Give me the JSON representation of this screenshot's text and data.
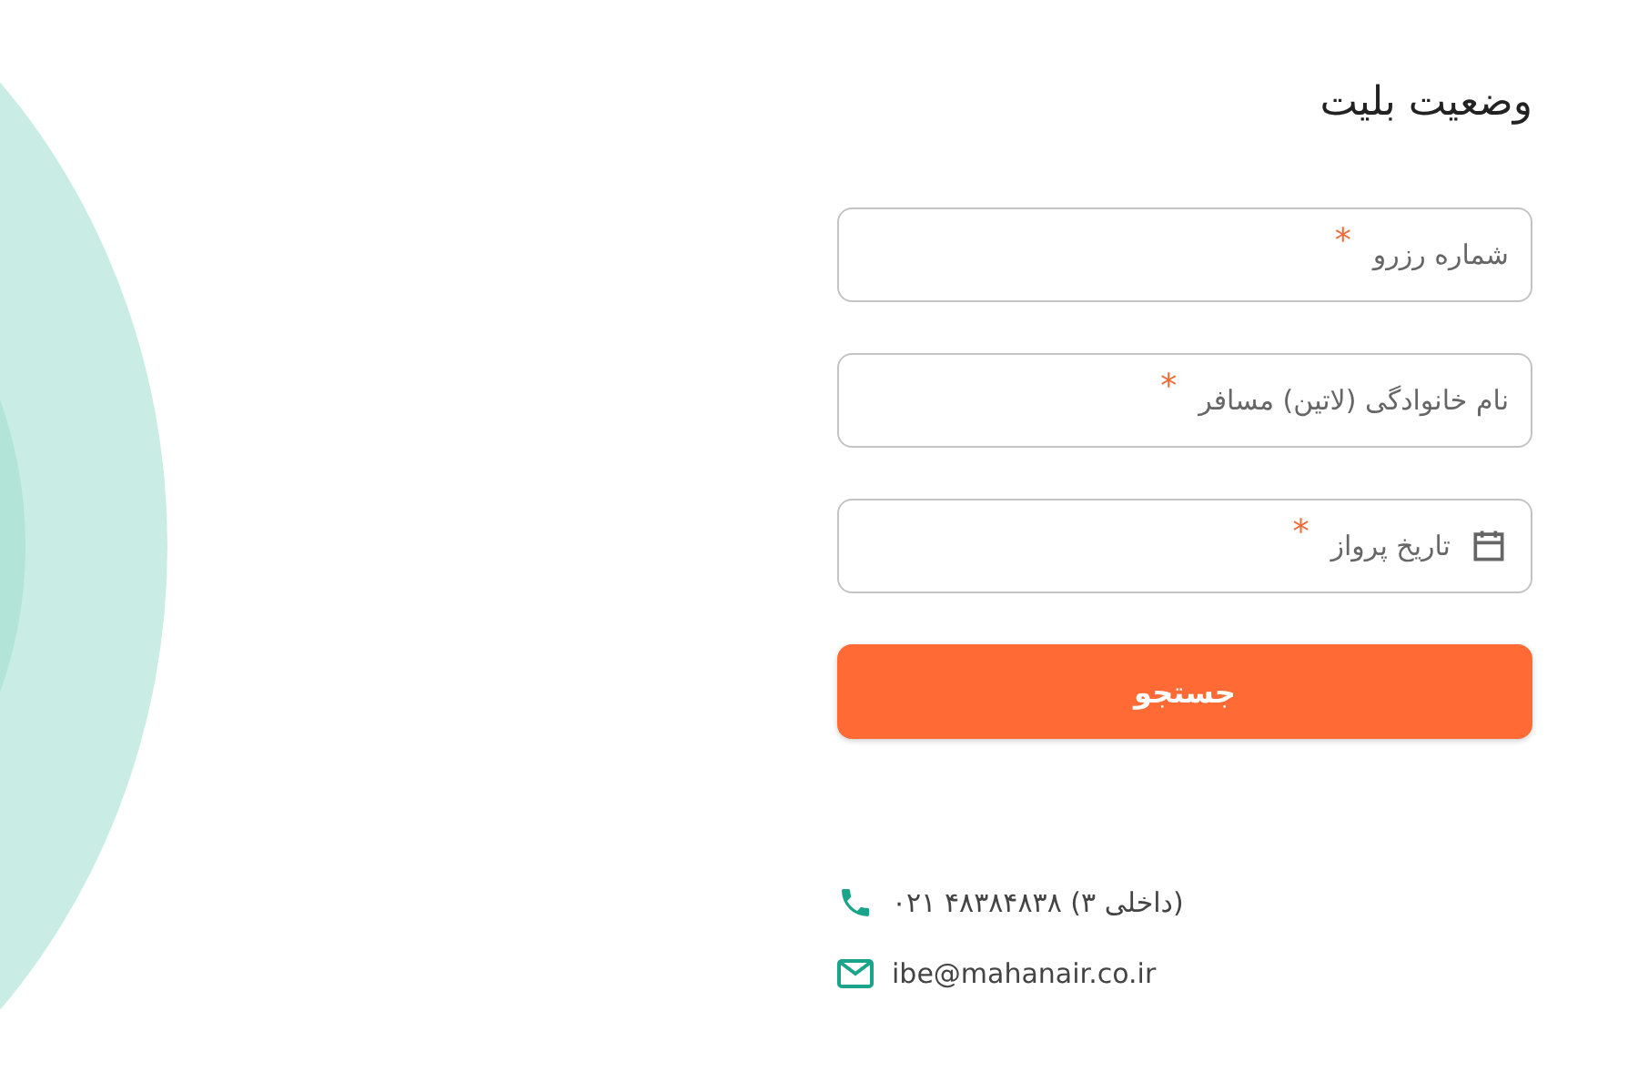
{
  "title": "وضعیت بلیت",
  "fields": [
    {
      "label": "شماره رزرو",
      "required_mark": "*",
      "kind": "text"
    },
    {
      "label": "نام خانوادگی (لاتین) مسافر",
      "required_mark": "*",
      "kind": "text"
    },
    {
      "label": "تاریخ پرواز",
      "required_mark": "*",
      "kind": "date"
    }
  ],
  "search_button": "جستجو",
  "contacts": [
    {
      "kind": "phone",
      "text": "(داخلی ۳) ۴۸۳۸۴۸۳۸ ۰۲۱"
    },
    {
      "kind": "email",
      "text": "ibe@mahanair.co.ir"
    }
  ]
}
